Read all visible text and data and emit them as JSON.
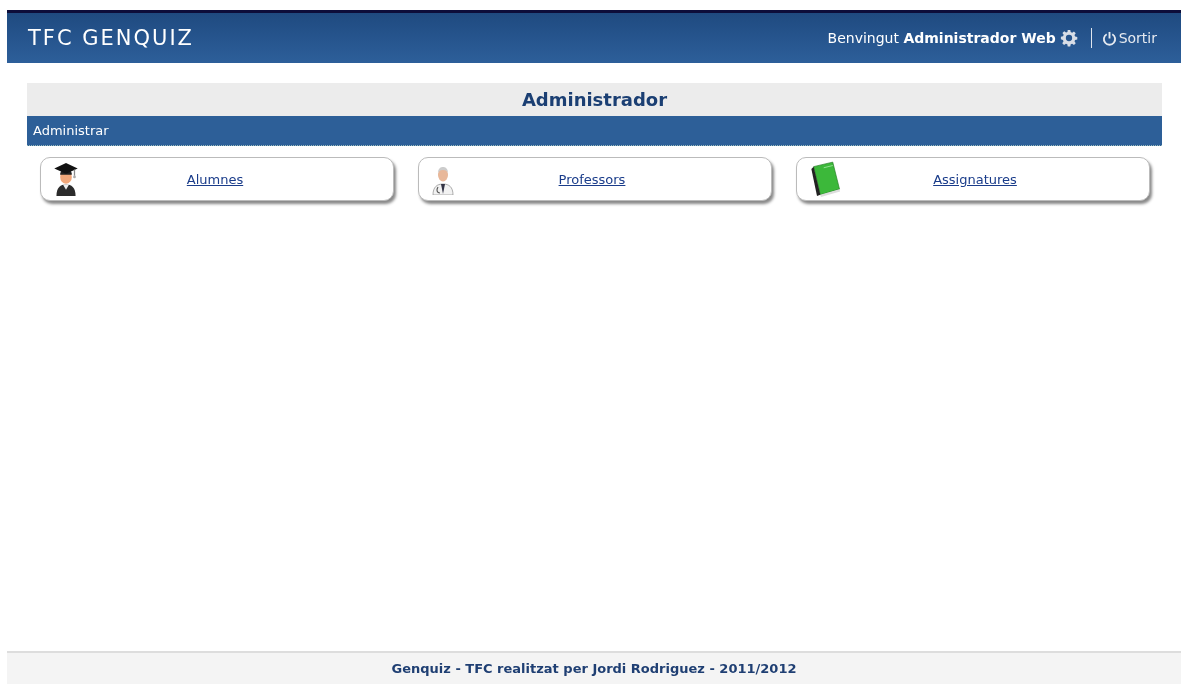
{
  "header": {
    "title": "TFC GENQUIZ",
    "welcome": "Benvingut **Administrador Web**",
    "logout": "Sortir"
  },
  "panel": {
    "title": "Administrador",
    "section": "Administrar",
    "cards": [
      {
        "label": "Alumnes",
        "kind": "student"
      },
      {
        "label": "Professors",
        "kind": "doctor"
      },
      {
        "label": "Assignatures",
        "kind": "book"
      }
    ]
  },
  "footer": "Genquiz - TFC realitzat per Jordi Rodriguez - 2011/2012"
}
